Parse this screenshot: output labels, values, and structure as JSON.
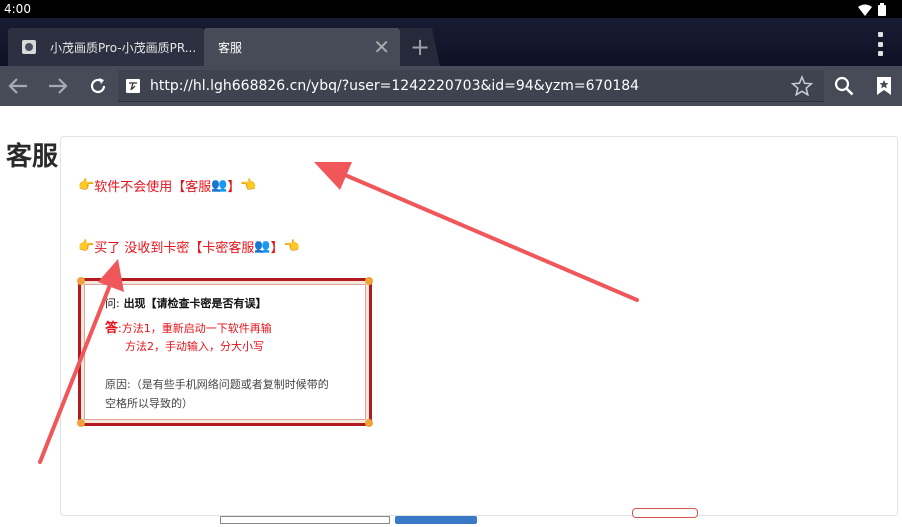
{
  "status_bar": {
    "time": "4:00"
  },
  "browser": {
    "tabs": [
      {
        "title": "小茂画质Pro-小茂画质PR...",
        "active": false
      },
      {
        "title": "客服",
        "active": true
      }
    ],
    "new_tab_glyph": "+",
    "url": "http://hl.lgh668826.cn/ybq/?user=1242220703&id=94&yzm=670184",
    "icons": [
      "back-icon",
      "forward-icon",
      "reload-icon",
      "star-icon",
      "search-icon",
      "bookmarks-icon",
      "menu-icon"
    ]
  },
  "page": {
    "heading": "客服",
    "links": [
      {
        "text": "软件不会使用【客服",
        "suffix": "】"
      },
      {
        "text": "买了 没收到卡密【卡密客服",
        "suffix": "】"
      }
    ],
    "note": {
      "q_label": "问:",
      "q_text": "出现【请检查卡密是否有误】",
      "a_label": "答",
      "a_line1": ":方法1，重新启动一下软件再输",
      "a_line2": "方法2，手动输入，分大小写",
      "reason_line1": "原因:（是有些手机网络问题或者复制时候带的",
      "reason_line2": "空格所以导致的）"
    }
  },
  "colors": {
    "link_red": "#e6121b",
    "arrow_red": "#f0575a",
    "note_border": "#b31a1f",
    "toolbar": "#474b57",
    "tabbar": "#151932"
  }
}
